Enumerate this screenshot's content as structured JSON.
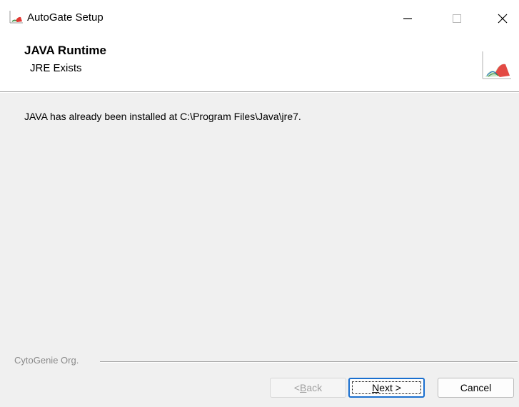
{
  "window": {
    "title": "AutoGate Setup"
  },
  "titlebar": {
    "minimize_icon": "minimize-icon",
    "maximize_icon": "maximize-icon",
    "close_icon": "close-icon"
  },
  "header": {
    "title": "JAVA Runtime",
    "subtitle": "JRE Exists",
    "logo_icon": "installer-logo-icon"
  },
  "content": {
    "message": "JAVA has already been installed at C:\\Program Files\\Java\\jre7."
  },
  "footer": {
    "brand": "CytoGenie Org.",
    "back": {
      "prefix": "< ",
      "accel": "B",
      "rest": "ack"
    },
    "next": {
      "accel": "N",
      "rest": "ext >"
    },
    "cancel": "Cancel"
  },
  "colors": {
    "accent": "#1a6fcf",
    "disabled_text": "#a0a0a0",
    "brand_text": "#8a8a8a"
  }
}
